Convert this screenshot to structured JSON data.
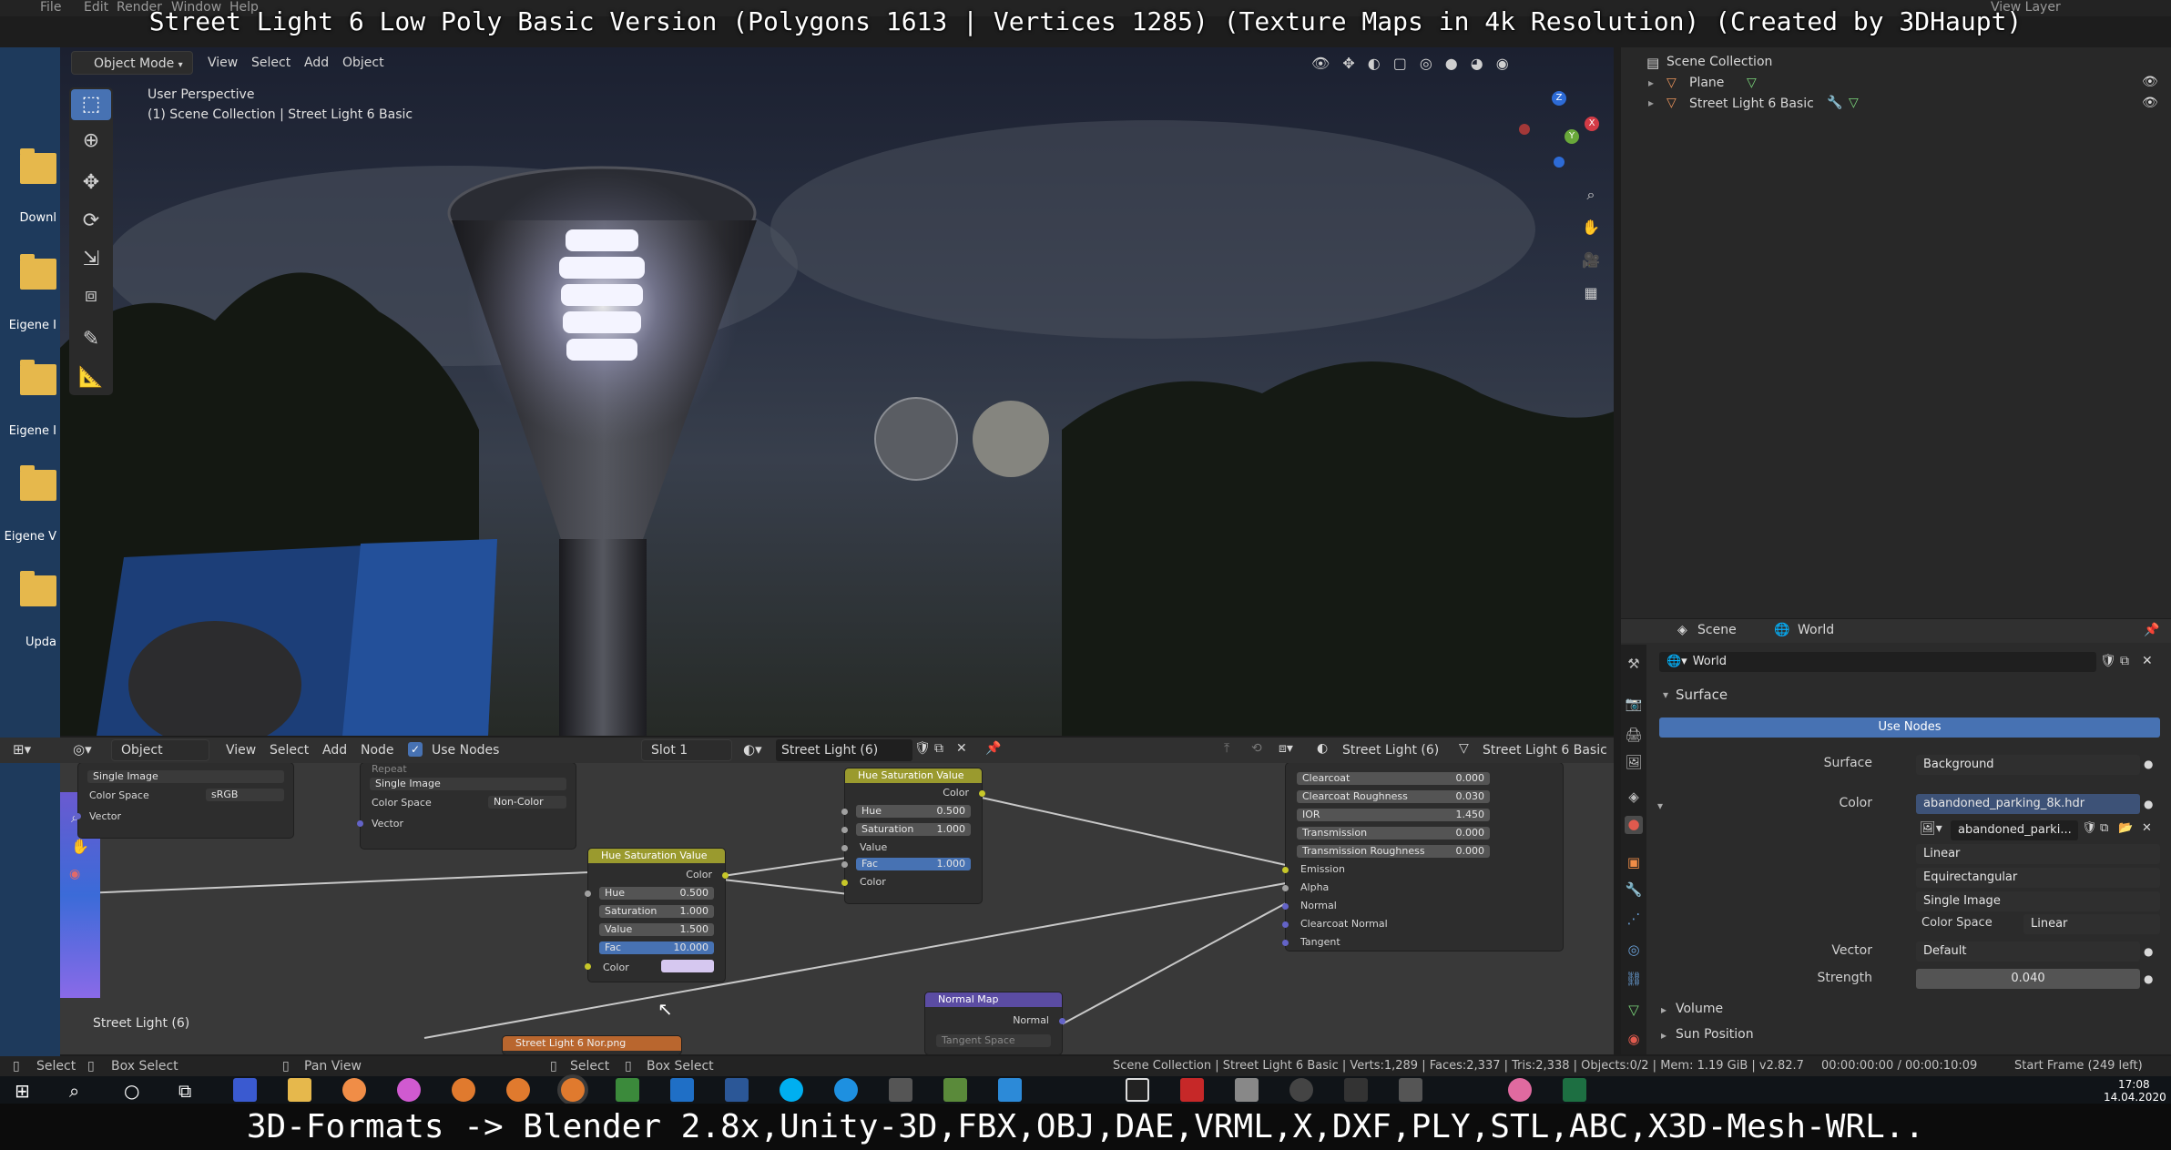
{
  "caption": {
    "top": "Street Light 6 Low Poly Basic Version (Polygons 1613 | Vertices 1285) (Texture Maps in 4k Resolution) (Created by 3DHaupt)",
    "bottom": "3D-Formats -> Blender 2.8x,Unity-3D,FBX,OBJ,DAE,VRML,X,DXF,PLY,STL,ABC,X3D-Mesh-WRL.."
  },
  "topbar": {
    "menu": [
      "File",
      "Edit",
      "Render",
      "Window",
      "Help"
    ],
    "right_label": "View Layer"
  },
  "desktop": {
    "icons": [
      "Downl",
      "Eigene I",
      "Eigene I",
      "Eigene V",
      "Upda"
    ],
    "folder_color": "#e6b84c"
  },
  "viewport": {
    "mode": "Object Mode",
    "menu": [
      "View",
      "Select",
      "Add",
      "Object"
    ],
    "perspective": "User Perspective",
    "collection": "(1) Scene Collection | Street Light 6 Basic",
    "tools": [
      "select-box-icon",
      "cursor-icon",
      "move-icon",
      "rotate-icon",
      "scale-icon",
      "transform-icon",
      "annotate-icon",
      "measure-icon"
    ],
    "gizmo": [
      "Z",
      "X",
      "Y"
    ]
  },
  "outliner": {
    "header": "Scene Collection",
    "items": [
      {
        "label": "Plane"
      },
      {
        "label": "Street Light 6 Basic"
      }
    ]
  },
  "properties": {
    "breadcrumb": [
      "Scene",
      "World"
    ],
    "world_name": "World",
    "section": "Surface",
    "use_nodes": "Use Nodes",
    "surface_label": "Surface",
    "surface_value": "Background",
    "color_label": "Color",
    "color_value": "abandoned_parking_8k.hdr",
    "image_name": "abandoned_parki...",
    "interp": "Linear",
    "projection": "Equirectangular",
    "source": "Single Image",
    "colorspace_label": "Color Space",
    "colorspace_value": "Linear",
    "vector_label": "Vector",
    "vector_value": "Default",
    "strength_label": "Strength",
    "strength_value": "0.040",
    "collapsed": [
      "Volume",
      "Sun Position"
    ]
  },
  "node_editor": {
    "type": "Object",
    "menu": [
      "View",
      "Select",
      "Add",
      "Node"
    ],
    "use_nodes": "Use Nodes",
    "slot": "Slot 1",
    "material": "Street Light (6)",
    "material_right": "Street Light (6)",
    "object_right": "Street Light 6 Basic",
    "footer_label": "Street Light (6)",
    "img1": {
      "source": "Single Image",
      "colorspace_label": "Color Space",
      "colorspace": "sRGB",
      "vector": "Vector"
    },
    "img2": {
      "repeat": "Repeat",
      "source": "Single Image",
      "colorspace_label": "Color Space",
      "colorspace": "Non-Color",
      "vector": "Vector"
    },
    "hsv1": {
      "title": "Hue Saturation Value",
      "out": "Color",
      "hue_l": "Hue",
      "hue": "0.500",
      "sat_l": "Saturation",
      "sat": "1.000",
      "val_l": "Value",
      "val": "1.500",
      "fac_l": "Fac",
      "fac": "10.000",
      "color_l": "Color"
    },
    "hsv2": {
      "title": "Hue Saturation Value",
      "out": "Color",
      "hue_l": "Hue",
      "hue": "0.500",
      "sat_l": "Saturation",
      "sat": "1.000",
      "val_l": "Value",
      "fac_l": "Fac",
      "fac": "1.000",
      "color_l": "Color"
    },
    "bsdf": [
      {
        "label": "Clearcoat",
        "value": "0.000"
      },
      {
        "label": "Clearcoat Roughness",
        "value": "0.030"
      },
      {
        "label": "IOR",
        "value": "1.450"
      },
      {
        "label": "Transmission",
        "value": "0.000"
      },
      {
        "label": "Transmission Roughness",
        "value": "0.000"
      }
    ],
    "bsdf_inputs": [
      "Emission",
      "Alpha",
      "Normal",
      "Clearcoat Normal",
      "Tangent"
    ],
    "normal_map": {
      "title": "Normal Map",
      "out": "Normal",
      "space": "Tangent Space"
    },
    "bottom_node": "Street Light 6 Nor.png"
  },
  "statusbar": {
    "left": [
      "Select",
      "Box Select",
      "Pan View",
      "Select",
      "Box Select"
    ],
    "info": "Scene Collection | Street Light 6 Basic | Verts:1,289 | Faces:2,337 | Tris:2,338 | Objects:0/2 | Mem: 1.19 GiB | v2.82.7",
    "time": "00:00:00:00 / 00:00:10:09",
    "frame": "Start Frame (249 left)"
  },
  "taskbar": {
    "clock_time": "17:08",
    "clock_date": "14.04.2020"
  }
}
